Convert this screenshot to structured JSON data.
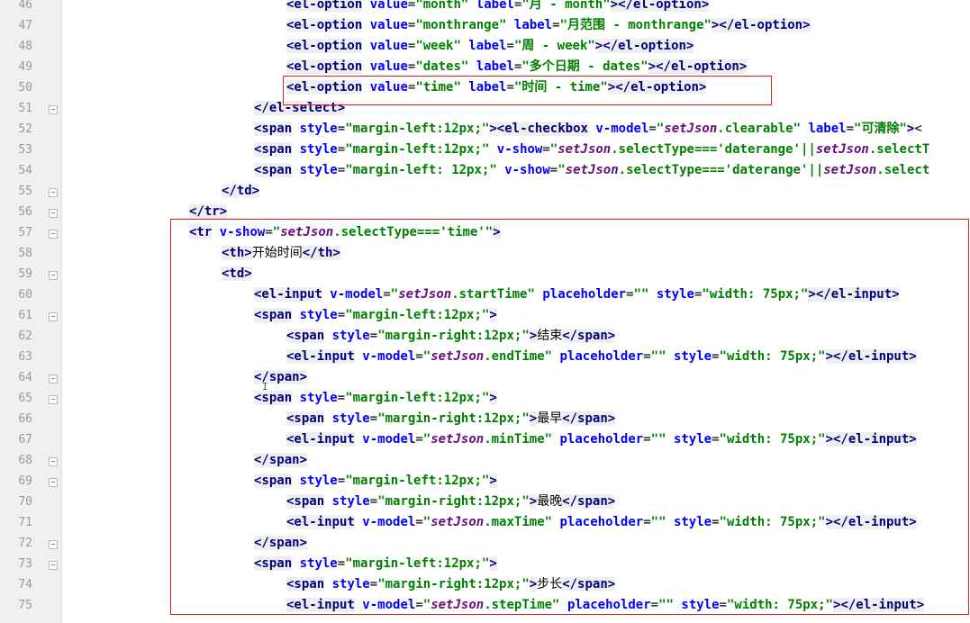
{
  "editor": {
    "lines": [
      {
        "n": "46",
        "indent": 318,
        "fold": false,
        "code": "<el-option value=\"month\" label=\"月 - month\"></el-option>"
      },
      {
        "n": "47",
        "indent": 318,
        "fold": false,
        "code": "<el-option value=\"monthrange\" label=\"月范围 - monthrange\"></el-option>"
      },
      {
        "n": "48",
        "indent": 318,
        "fold": false,
        "code": "<el-option value=\"week\" label=\"周 - week\"></el-option>"
      },
      {
        "n": "49",
        "indent": 318,
        "fold": false,
        "code": "<el-option value=\"dates\" label=\"多个日期 - dates\"></el-option>"
      },
      {
        "n": "50",
        "indent": 318,
        "fold": false,
        "code": "<el-option value=\"time\" label=\"时间 - time\"></el-option>"
      },
      {
        "n": "51",
        "indent": 282,
        "fold": true,
        "code": "</el-select>"
      },
      {
        "n": "52",
        "indent": 282,
        "fold": false,
        "code": "<span style=\"margin-left:12px;\"><el-checkbox v-model=\"setJson.clearable\" label=\"可清除\"><"
      },
      {
        "n": "53",
        "indent": 282,
        "fold": false,
        "code": "<span style=\"margin-left:12px;\" v-show=\"setJson.selectType==='daterange'||setJson.selectT"
      },
      {
        "n": "54",
        "indent": 282,
        "fold": false,
        "code": "<span style=\"margin-left: 12px;\" v-show=\"setJson.selectType==='daterange'||setJson.select"
      },
      {
        "n": "55",
        "indent": 246,
        "fold": true,
        "code": "</td>"
      },
      {
        "n": "56",
        "indent": 210,
        "fold": true,
        "code": "</tr>"
      },
      {
        "n": "57",
        "indent": 210,
        "fold": true,
        "code": "<tr v-show=\"setJson.selectType==='time'\">"
      },
      {
        "n": "58",
        "indent": 246,
        "fold": false,
        "code": "<th>开始时间</th>"
      },
      {
        "n": "59",
        "indent": 246,
        "fold": true,
        "code": "<td>"
      },
      {
        "n": "60",
        "indent": 282,
        "fold": false,
        "code": "<el-input v-model=\"setJson.startTime\" placeholder=\"\" style=\"width: 75px;\"></el-input>"
      },
      {
        "n": "61",
        "indent": 282,
        "fold": true,
        "code": "<span style=\"margin-left:12px;\">"
      },
      {
        "n": "62",
        "indent": 318,
        "fold": false,
        "code": "<span style=\"margin-right:12px;\">结束</span>"
      },
      {
        "n": "63",
        "indent": 318,
        "fold": false,
        "code": "<el-input v-model=\"setJson.endTime\" placeholder=\"\" style=\"width: 75px;\"></el-input>"
      },
      {
        "n": "64",
        "indent": 282,
        "fold": true,
        "code": "</span>"
      },
      {
        "n": "65",
        "indent": 282,
        "fold": true,
        "code": "<span style=\"margin-left:12px;\">"
      },
      {
        "n": "66",
        "indent": 318,
        "fold": false,
        "code": "<span style=\"margin-right:12px;\">最早</span>"
      },
      {
        "n": "67",
        "indent": 318,
        "fold": false,
        "code": "<el-input v-model=\"setJson.minTime\" placeholder=\"\" style=\"width: 75px;\"></el-input>"
      },
      {
        "n": "68",
        "indent": 282,
        "fold": true,
        "code": "</span>"
      },
      {
        "n": "69",
        "indent": 282,
        "fold": true,
        "code": "<span style=\"margin-left:12px;\">"
      },
      {
        "n": "70",
        "indent": 318,
        "fold": false,
        "code": "<span style=\"margin-right:12px;\">最晚</span>"
      },
      {
        "n": "71",
        "indent": 318,
        "fold": false,
        "code": "<el-input v-model=\"setJson.maxTime\" placeholder=\"\" style=\"width: 75px;\"></el-input>"
      },
      {
        "n": "72",
        "indent": 282,
        "fold": true,
        "code": "</span>"
      },
      {
        "n": "73",
        "indent": 282,
        "fold": true,
        "code": "<span style=\"margin-left:12px;\">"
      },
      {
        "n": "74",
        "indent": 318,
        "fold": false,
        "code": "<span style=\"margin-right:12px;\">步长</span>"
      },
      {
        "n": "75",
        "indent": 318,
        "fold": false,
        "code": "<el-input v-model=\"setJson.stepTime\" placeholder=\"\" style=\"width: 75px;\"></el-input>"
      }
    ]
  },
  "colors": {
    "tag": "#000080",
    "attribute": "#0000ff",
    "string": "#008000",
    "variable": "#660e7a",
    "annotation_box": "#e02020"
  }
}
